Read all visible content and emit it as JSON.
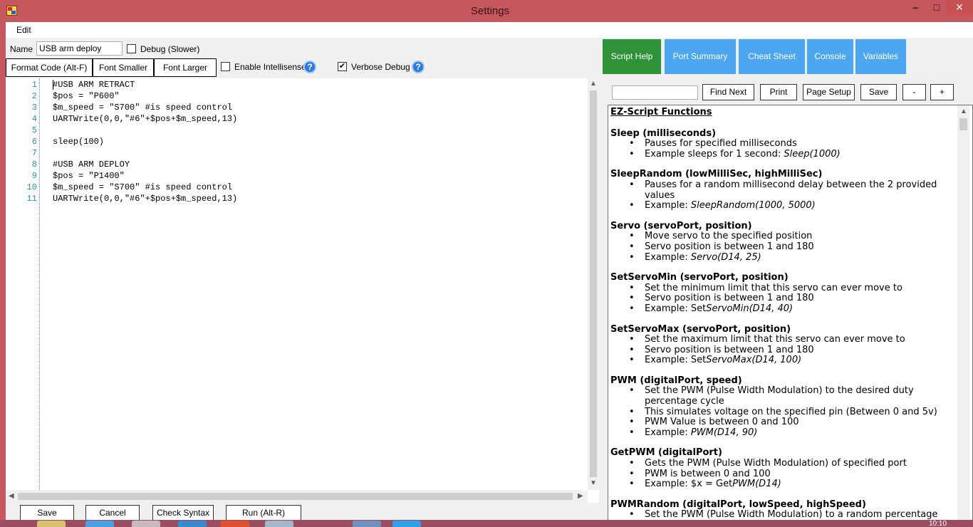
{
  "window": {
    "title": "Settings",
    "min_glyph": "–",
    "max_glyph": "□",
    "close_glyph": "✕"
  },
  "menu": {
    "edit": "Edit"
  },
  "form": {
    "name_label": "Name",
    "name_value": "USB arm deploy",
    "debug_label": "Debug (Slower)",
    "debug_checked": false,
    "intellisense_label": "Enable Intellisense",
    "intellisense_checked": false,
    "verbose_label": "Verbose Debug",
    "verbose_checked": true,
    "check_glyph": "✔",
    "help_glyph": "?"
  },
  "toolbar": {
    "format_code": "Format Code (Alt-F)",
    "font_smaller": "Font Smaller",
    "font_larger": "Font Larger"
  },
  "editor": {
    "lines": [
      {
        "num": "1",
        "code": "#USB ARM RETRACT"
      },
      {
        "num": "2",
        "code": "$pos = \"P600\""
      },
      {
        "num": "3",
        "code": "$m_speed = \"S700\" #is speed control"
      },
      {
        "num": "4",
        "code": "UARTWrite(0,0,\"#6\"+$pos+$m_speed,13)"
      },
      {
        "num": "5",
        "code": ""
      },
      {
        "num": "6",
        "code": "sleep(100)"
      },
      {
        "num": "7",
        "code": ""
      },
      {
        "num": "8",
        "code": "#USB ARM DEPLOY"
      },
      {
        "num": "9",
        "code": "$pos = \"P1400\""
      },
      {
        "num": "10",
        "code": "$m_speed = \"S700\" #is speed control"
      },
      {
        "num": "11",
        "code": "UARTWrite(0,0,\"#6\"+$pos+$m_speed,13)"
      }
    ]
  },
  "bottom": {
    "save": "Save",
    "cancel": "Cancel",
    "check_syntax": "Check Syntax",
    "run": "Run  (Alt-R)"
  },
  "tabs": [
    {
      "label": "Script Help",
      "active": true
    },
    {
      "label": "Port Summary",
      "active": false
    },
    {
      "label": "Cheat Sheet",
      "active": false
    },
    {
      "label": "Console",
      "active": false
    },
    {
      "label": "Variables",
      "active": false
    }
  ],
  "search": {
    "value": "",
    "find_next": "Find Next",
    "print": "Print",
    "page_setup": "Page Setup",
    "save": "Save",
    "zoom_out": "-",
    "zoom_in": "+"
  },
  "help": {
    "title": "EZ-Script Functions",
    "functions": [
      {
        "name": "Sleep (milliseconds)",
        "items": [
          {
            "text": "Pauses for specified milliseconds",
            "example": ""
          },
          {
            "text": "Example sleeps for 1 second: ",
            "example": "Sleep(1000)"
          }
        ]
      },
      {
        "name": "SleepRandom (lowMilliSec, highMilliSec)",
        "items": [
          {
            "text": "Pauses for a random millisecond delay between the 2 provided values",
            "example": ""
          },
          {
            "text": "Example: ",
            "example": "SleepRandom(1000, 5000)"
          }
        ]
      },
      {
        "name": "Servo (servoPort, position)",
        "items": [
          {
            "text": "Move servo to the specified position",
            "example": ""
          },
          {
            "text": "Servo position is between 1 and 180",
            "example": ""
          },
          {
            "text": "Example: ",
            "example": "Servo(D14, 25)"
          }
        ]
      },
      {
        "name": "SetServoMin (servoPort, position)",
        "items": [
          {
            "text": "Set the minimum limit that this servo can ever move to",
            "example": ""
          },
          {
            "text": "Servo position is between 1 and 180",
            "example": ""
          },
          {
            "text": "Example: Set",
            "example": "ServoMin(D14, 40)"
          }
        ]
      },
      {
        "name": "SetServoMax (servoPort, position)",
        "items": [
          {
            "text": "Set the maximum limit that this servo can ever move to",
            "example": ""
          },
          {
            "text": "Servo position is between 1 and 180",
            "example": ""
          },
          {
            "text": "Example: Set",
            "example": "ServoMax(D14, 100)"
          }
        ]
      },
      {
        "name": "PWM (digitalPort, speed)",
        "items": [
          {
            "text": "Set the PWM (Pulse Width Modulation) to the desired duty percentage cycle",
            "example": ""
          },
          {
            "text": "This simulates voltage on the specified pin (Between 0 and 5v)",
            "example": ""
          },
          {
            "text": "PWM Value is between 0 and 100",
            "example": ""
          },
          {
            "text": "Example: ",
            "example": "PWM(D14, 90)"
          }
        ]
      },
      {
        "name": "GetPWM (digitalPort)",
        "items": [
          {
            "text": "Gets the PWM (Pulse Width Modulation) of specified port",
            "example": ""
          },
          {
            "text": "PWM is between 0 and 100",
            "example": ""
          },
          {
            "text": "Example: $x = Get",
            "example": "PWM(D14)"
          }
        ]
      },
      {
        "name": "PWMRandom (digitalPort, lowSpeed, highSpeed)",
        "items": [
          {
            "text": "Set the PWM (Pulse Width Modulation) to a random percentage duty cycle",
            "example": ""
          }
        ]
      }
    ]
  },
  "taskbar": {
    "clock": "10:10"
  },
  "colors": {
    "title_bar": "#c4585e",
    "active_tab": "#2f9138",
    "inactive_tab": "#4da6f0",
    "line_number": "#2b91af",
    "help_icon": "#2b7ad6"
  }
}
